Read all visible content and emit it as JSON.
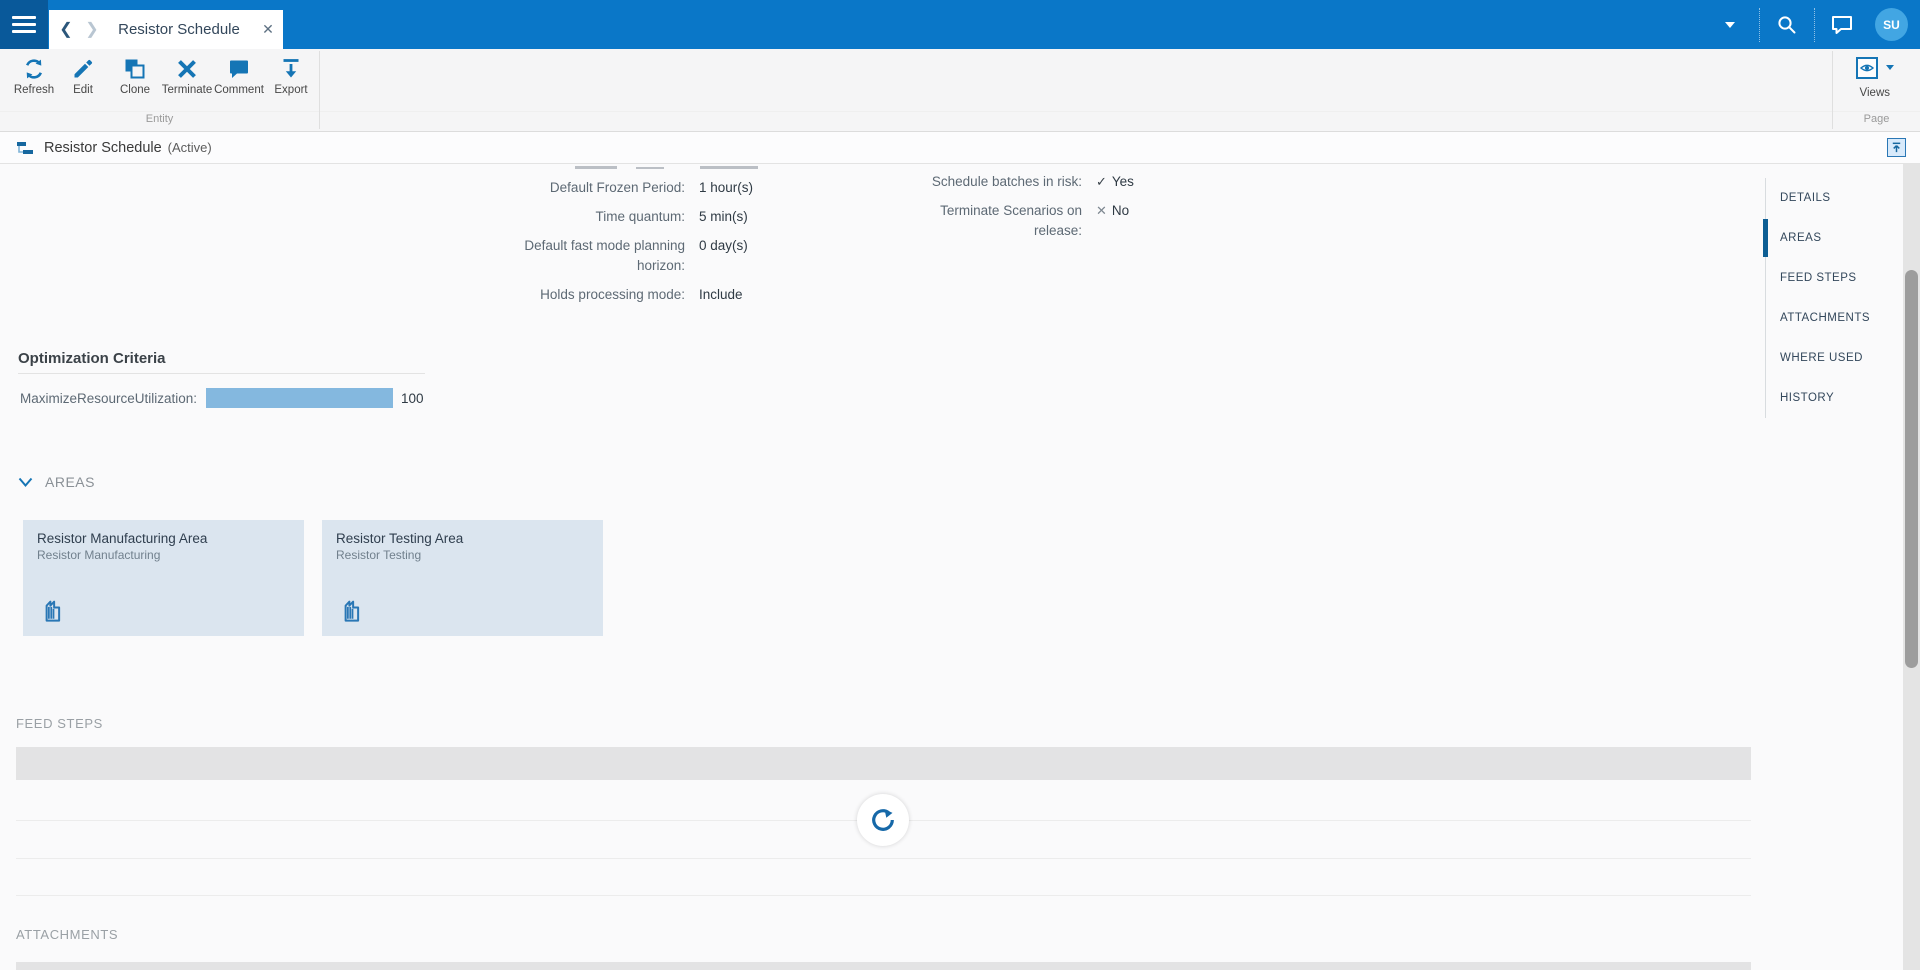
{
  "colors": {
    "topbar_blue": "#0a77c8",
    "hamburger_blue": "#09599a",
    "accent_blue": "#1575b5",
    "avatar_blue": "#42a6e3",
    "active_nav_indicator": "#0d5e94",
    "progress_bar": "#84b8df",
    "card_bg": "#dbe5ef",
    "skeleton_gray": "#e3e3e4"
  },
  "topbar": {
    "tab_title": "Resistor Schedule",
    "avatar_initials": "SU"
  },
  "toolbar": {
    "buttons": [
      {
        "label": "Refresh"
      },
      {
        "label": "Edit"
      },
      {
        "label": "Clone"
      },
      {
        "label": "Terminate"
      },
      {
        "label": "Comment"
      },
      {
        "label": "Export"
      }
    ],
    "entity_group_label": "Entity",
    "views_label": "Views",
    "page_group_label": "Page"
  },
  "breadcrumb": {
    "title": "Resistor Schedule",
    "status": "(Active)"
  },
  "details": {
    "left_rows": [
      {
        "label": "Default Frozen Period:",
        "value": "1 hour(s)"
      },
      {
        "label": "Time quantum:",
        "value": "5 min(s)"
      },
      {
        "label": "Default fast mode planning horizon:",
        "value": "0 day(s)"
      },
      {
        "label": "Holds processing mode:",
        "value": "Include"
      }
    ],
    "right_rows": [
      {
        "label": "Schedule batches in risk:",
        "mark": "✓",
        "value": "Yes"
      },
      {
        "label": "Terminate Scenarios on release:",
        "mark": "✕",
        "value": "No"
      }
    ]
  },
  "optimization": {
    "heading": "Optimization Criteria",
    "rows": [
      {
        "label": "MaximizeResourceUtilization:",
        "value": "100",
        "max": 100
      }
    ]
  },
  "areas": {
    "heading": "AREAS",
    "cards": [
      {
        "title": "Resistor Manufacturing Area",
        "subtitle": "Resistor Manufacturing"
      },
      {
        "title": "Resistor Testing Area",
        "subtitle": "Resistor Testing"
      }
    ]
  },
  "feed_steps": {
    "heading": "FEED STEPS"
  },
  "attachments": {
    "heading": "ATTACHMENTS"
  },
  "side_nav": {
    "items": [
      {
        "label": "DETAILS"
      },
      {
        "label": "AREAS"
      },
      {
        "label": "FEED STEPS"
      },
      {
        "label": "ATTACHMENTS"
      },
      {
        "label": "WHERE USED"
      },
      {
        "label": "HISTORY"
      }
    ],
    "active": "AREAS"
  }
}
